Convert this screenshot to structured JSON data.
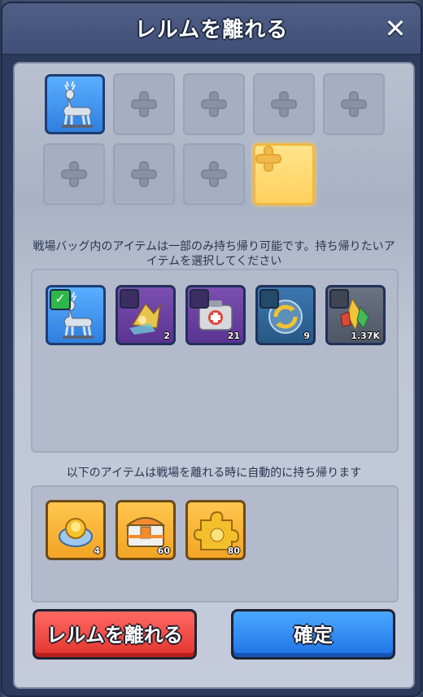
{
  "dialog": {
    "title": "レルムを離れる",
    "close_icon": "close-icon"
  },
  "top_slots": {
    "filled": [
      {
        "icon": "deer-statue-icon"
      }
    ],
    "empty_count": 7,
    "highlighted_empty_count": 1
  },
  "carry_section": {
    "instruction": "戦場バッグ内のアイテムは一部のみ持ち帰り可能です。持ち帰りたいアイテムを選択してください",
    "items": [
      {
        "icon": "deer-statue-icon",
        "rarity": "blue",
        "selected": true,
        "count": ""
      },
      {
        "icon": "energy-crystal-icon",
        "rarity": "purple",
        "selected": false,
        "count": "2"
      },
      {
        "icon": "medkit-icon",
        "rarity": "purple",
        "selected": false,
        "count": "21"
      },
      {
        "icon": "cycle-orb-icon",
        "rarity": "teal",
        "selected": false,
        "count": "9"
      },
      {
        "icon": "gem-cluster-icon",
        "rarity": "gray",
        "selected": false,
        "count": "1.37K"
      }
    ]
  },
  "auto_section": {
    "instruction": "以下のアイテムは戦場を離れる時に自動的に持ち帰ります",
    "items": [
      {
        "icon": "gold-core-icon",
        "count": "4"
      },
      {
        "icon": "treasure-chest-icon",
        "count": "60"
      },
      {
        "icon": "gold-puzzle-piece-icon",
        "count": "80"
      }
    ]
  },
  "buttons": {
    "leave_label": "レルムを離れる",
    "confirm_label": "確定"
  },
  "colors": {
    "leave_button": "#e2332c",
    "confirm_button": "#1f72e6",
    "highlight_slot": "#ffd05e"
  }
}
